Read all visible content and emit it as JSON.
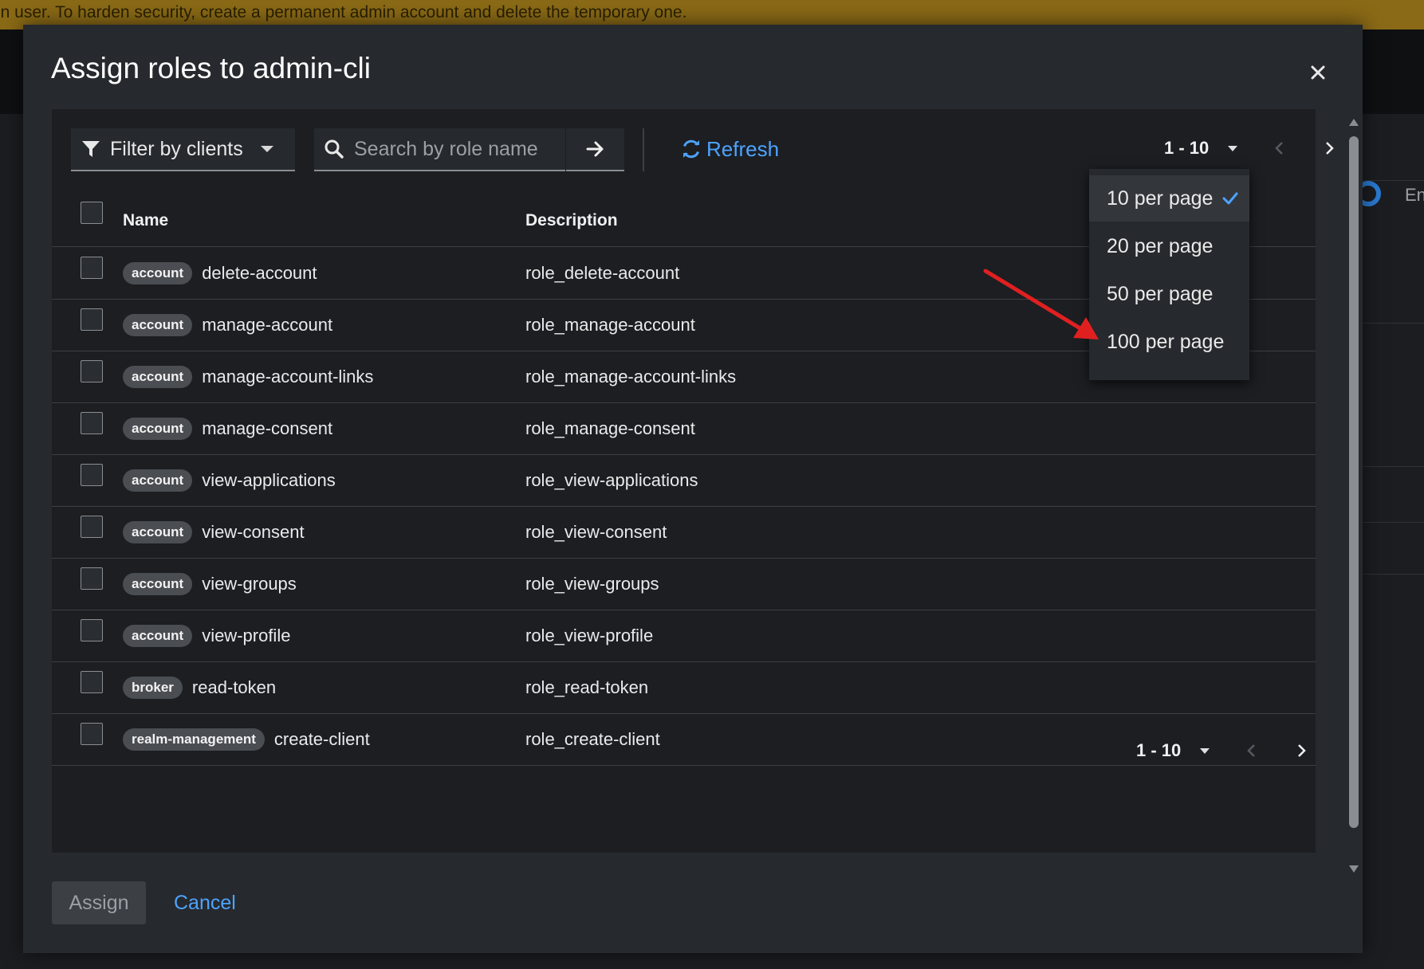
{
  "banner": {
    "text": "in user. To harden security, create a permanent admin account and delete the temporary one."
  },
  "background": {
    "partial_text": "En"
  },
  "modal": {
    "title": "Assign roles to admin-cli",
    "close_icon": "close-icon"
  },
  "toolbar": {
    "filter_label": "Filter by clients",
    "search_placeholder": "Search by role name",
    "refresh_label": "Refresh"
  },
  "pagination_top": {
    "range": "1 - 10"
  },
  "pagination_bottom": {
    "range": "1 - 10"
  },
  "per_page_menu": {
    "items": [
      {
        "label": "10 per page",
        "selected": true
      },
      {
        "label": "20 per page",
        "selected": false
      },
      {
        "label": "50 per page",
        "selected": false
      },
      {
        "label": "100 per page",
        "selected": false
      }
    ]
  },
  "table": {
    "headers": {
      "name": "Name",
      "description": "Description"
    },
    "rows": [
      {
        "client": "account",
        "name": "delete-account",
        "description": "role_delete-account"
      },
      {
        "client": "account",
        "name": "manage-account",
        "description": "role_manage-account"
      },
      {
        "client": "account",
        "name": "manage-account-links",
        "description": "role_manage-account-links"
      },
      {
        "client": "account",
        "name": "manage-consent",
        "description": "role_manage-consent"
      },
      {
        "client": "account",
        "name": "view-applications",
        "description": "role_view-applications"
      },
      {
        "client": "account",
        "name": "view-consent",
        "description": "role_view-consent"
      },
      {
        "client": "account",
        "name": "view-groups",
        "description": "role_view-groups"
      },
      {
        "client": "account",
        "name": "view-profile",
        "description": "role_view-profile"
      },
      {
        "client": "broker",
        "name": "read-token",
        "description": "role_read-token"
      },
      {
        "client": "realm-management",
        "name": "create-client",
        "description": "role_create-client"
      }
    ]
  },
  "footer": {
    "assign_label": "Assign",
    "cancel_label": "Cancel"
  },
  "colors": {
    "accent": "#4da3ff",
    "annotation": "#e02020",
    "banner": "#8a6a16"
  }
}
